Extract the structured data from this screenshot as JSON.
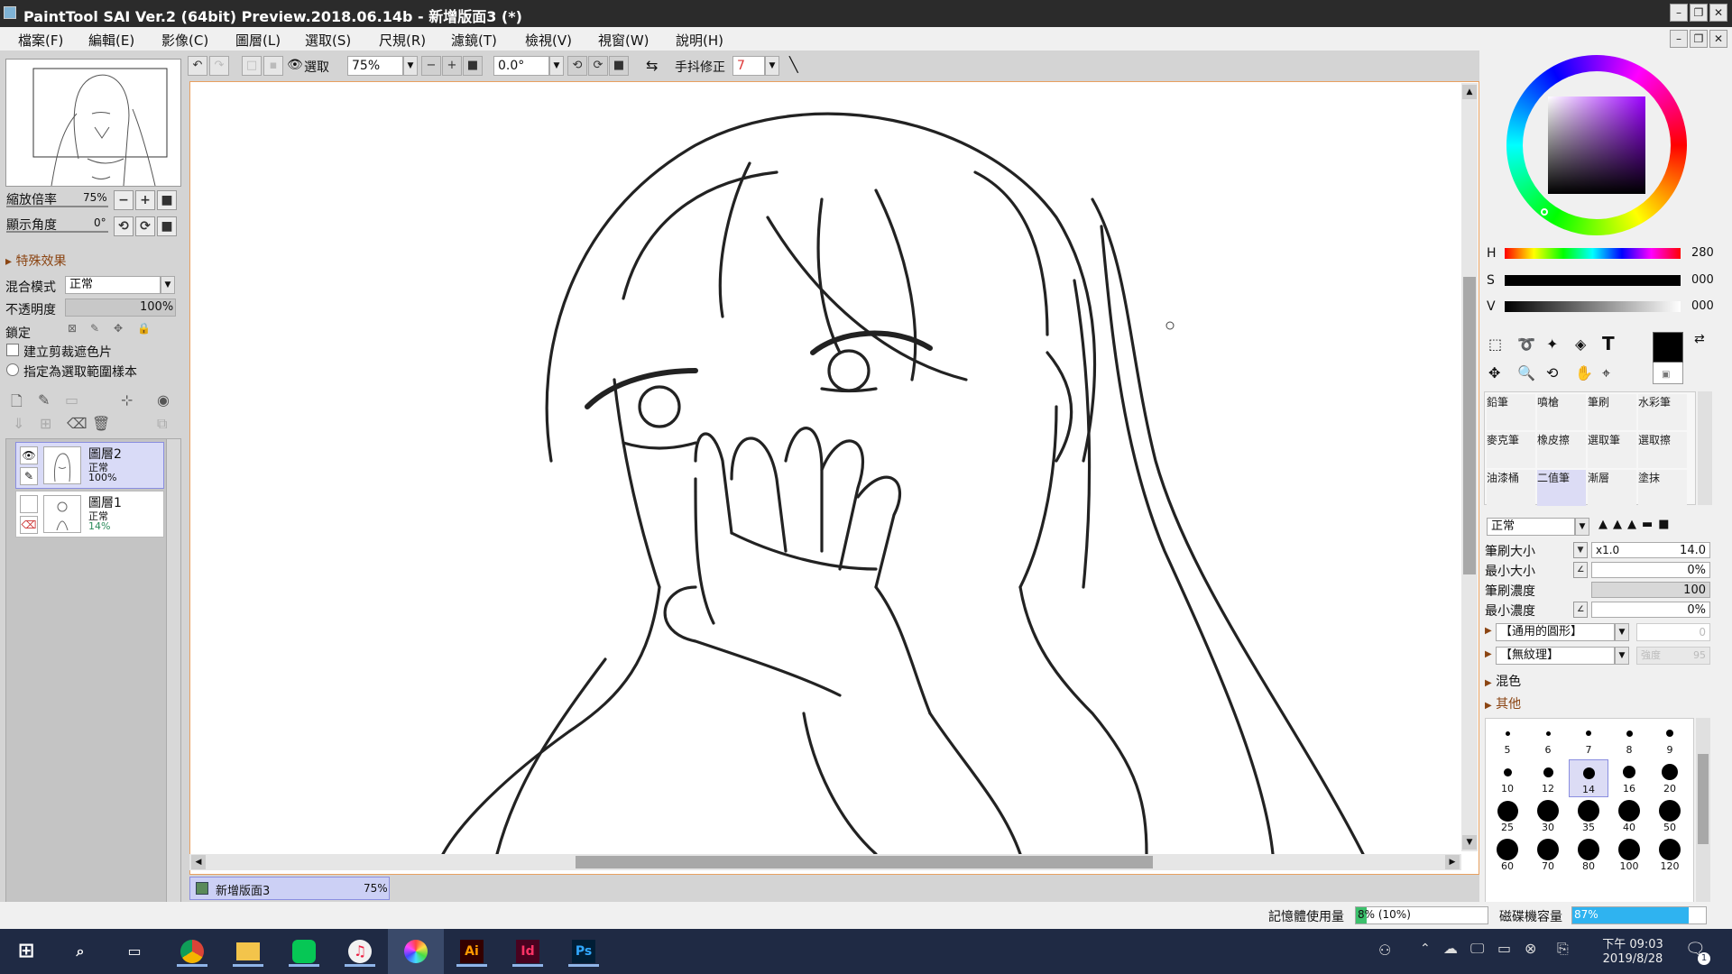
{
  "window": {
    "title": "PaintTool SAI Ver.2 (64bit) Preview.2018.06.14b - 新增版面3 (*)",
    "minimize_glyph": "–",
    "maximize_glyph": "❐",
    "close_glyph": "✕"
  },
  "menu": [
    "檔案(F)",
    "編輯(E)",
    "影像(C)",
    "圖層(L)",
    "選取(S)",
    "尺規(R)",
    "濾鏡(T)",
    "檢視(V)",
    "視窗(W)",
    "說明(H)"
  ],
  "toolbar": {
    "select_label": "選取",
    "zoom_value": "75%",
    "angle_value": "0.0°",
    "stabilizer_label": "手抖修正",
    "stabilizer_value": "7"
  },
  "navigator": {
    "zoom_label": "縮放倍率",
    "zoom_value": "75%",
    "angle_label": "顯示角度",
    "angle_value": "0°"
  },
  "layer_props": {
    "special_effects": "特殊效果",
    "blend_label": "混合模式",
    "blend_value": "正常",
    "opacity_label": "不透明度",
    "opacity_value": "100%",
    "lock_label": "鎖定",
    "clip_label": "建立剪裁遮色片",
    "selection_source_label": "指定為選取範圍樣本"
  },
  "layers": [
    {
      "name": "圖層2",
      "mode": "正常",
      "opacity": "100%",
      "selected": true,
      "visible": true
    },
    {
      "name": "圖層1",
      "mode": "正常",
      "opacity": "14%",
      "selected": false,
      "visible": false
    }
  ],
  "document_tab": {
    "name": "新增版面3",
    "zoom": "75%"
  },
  "color": {
    "h_label": "H",
    "h_value": "280",
    "s_label": "S",
    "s_value": "000",
    "v_label": "V",
    "v_value": "000",
    "primary": "#000000",
    "secondary": "#ffffff"
  },
  "brush_tools": [
    {
      "name": "鉛筆",
      "selected": false
    },
    {
      "name": "噴槍",
      "selected": false
    },
    {
      "name": "筆刷",
      "selected": false
    },
    {
      "name": "水彩筆",
      "selected": false
    },
    {
      "name": "麥克筆",
      "selected": false
    },
    {
      "name": "橡皮擦",
      "selected": false
    },
    {
      "name": "選取筆",
      "selected": false
    },
    {
      "name": "選取擦",
      "selected": false
    },
    {
      "name": "油漆桶",
      "selected": false
    },
    {
      "name": "二值筆",
      "selected": true
    },
    {
      "name": "漸層",
      "selected": false
    },
    {
      "name": "塗抹",
      "selected": false
    }
  ],
  "brush_settings": {
    "mode": "正常",
    "size_label": "筆刷大小",
    "size_multiplier": "x1.0",
    "size_value": "14.0",
    "min_size_label": "最小大小",
    "min_size_value": "0%",
    "density_label": "筆刷濃度",
    "density_value": "100",
    "min_density_label": "最小濃度",
    "min_density_value": "0%",
    "shape_value": "【通用的圓形】",
    "shape_amount": "0",
    "texture_value": "【無紋理】",
    "texture_strength_label": "強度",
    "texture_strength_value": "95",
    "mix_label": "混色",
    "other_label": "其他"
  },
  "brush_sizes": [
    "5",
    "6",
    "7",
    "8",
    "9",
    "10",
    "12",
    "14",
    "16",
    "20",
    "25",
    "30",
    "35",
    "40",
    "50",
    "60",
    "70",
    "80",
    "100",
    "120"
  ],
  "brush_size_selected": "14",
  "status": {
    "memory_label": "記憶體使用量",
    "memory_value": "8% (10%)",
    "memory_fraction": 0.08,
    "disk_label": "磁碟機容量",
    "disk_value": "87%",
    "disk_fraction": 0.87
  },
  "taskbar": {
    "time": "下午 09:03",
    "date": "2019/8/28",
    "notification_count": "1",
    "apps": [
      "Ai",
      "Id",
      "Ps"
    ]
  },
  "icons": {
    "search": "search-icon",
    "task_view": "task-view-icon",
    "trash": "trash-icon",
    "eye": "eye-icon",
    "pencil": "pencil-icon",
    "text_tool": "T"
  }
}
